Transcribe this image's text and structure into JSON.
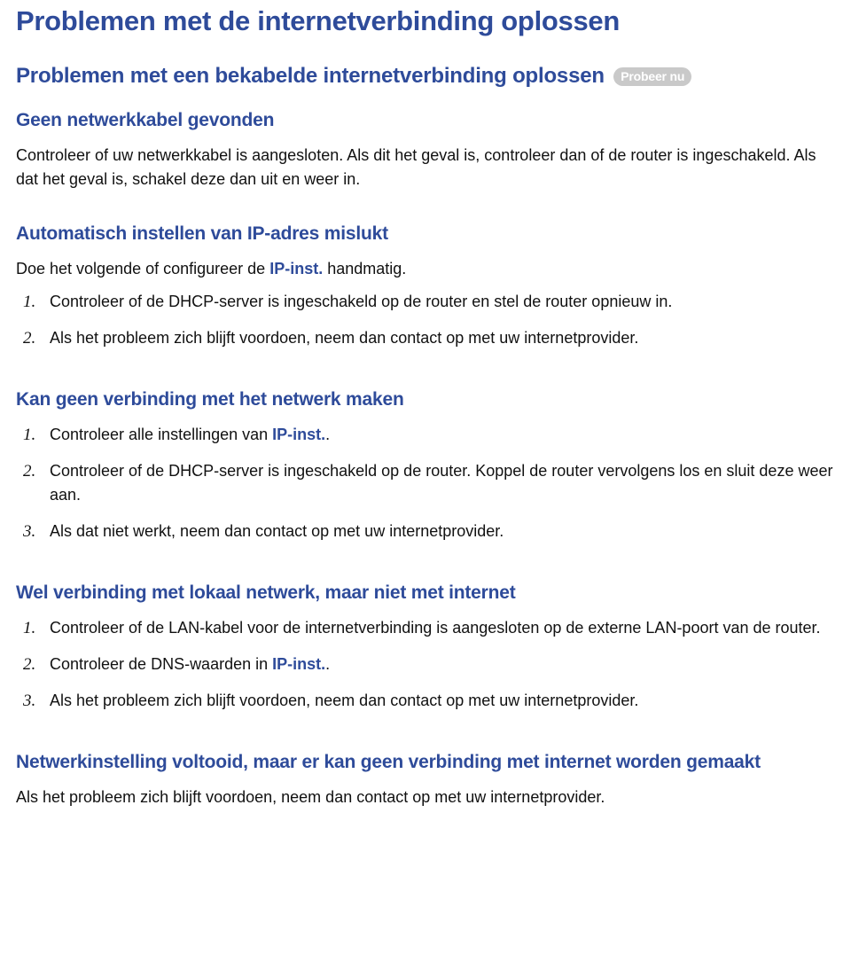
{
  "title": "Problemen met de internetverbinding oplossen",
  "wired": {
    "heading": "Problemen met een bekabelde internetverbinding oplossen",
    "badge": "Probeer nu"
  },
  "sec1": {
    "heading": "Geen netwerkkabel gevonden",
    "body": "Controleer of uw netwerkkabel is aangesloten. Als dit het geval is, controleer dan of de router is ingeschakeld. Als dat het geval is, schakel deze dan uit en weer in."
  },
  "sec2": {
    "heading": "Automatisch instellen van IP-adres mislukt",
    "intro_prefix": "Doe het volgende of configureer de ",
    "ip_inst": "IP-inst.",
    "intro_suffix": " handmatig.",
    "item1": "Controleer of de DHCP-server is ingeschakeld op de router en stel de router opnieuw in.",
    "item2": "Als het probleem zich blijft voordoen, neem dan contact op met uw internetprovider."
  },
  "sec3": {
    "heading": "Kan geen verbinding met het netwerk maken",
    "item1_prefix": "Controleer alle instellingen van ",
    "ip_inst": "IP-inst.",
    "item1_suffix": ".",
    "item2": "Controleer of de DHCP-server is ingeschakeld op de router. Koppel de router vervolgens los en sluit deze weer aan.",
    "item3": "Als dat niet werkt, neem dan contact op met uw internetprovider."
  },
  "sec4": {
    "heading": "Wel verbinding met lokaal netwerk, maar niet met internet",
    "item1": "Controleer of de LAN-kabel voor de internetverbinding is aangesloten op de externe LAN-poort van de router.",
    "item2_prefix": "Controleer de DNS-waarden in ",
    "ip_inst": "IP-inst.",
    "item2_suffix": ".",
    "item3": "Als het probleem zich blijft voordoen, neem dan contact op met uw internetprovider."
  },
  "sec5": {
    "heading": "Netwerkinstelling voltooid, maar er kan geen verbinding met internet worden gemaakt",
    "body": "Als het probleem zich blijft voordoen, neem dan contact op met uw internetprovider."
  },
  "nums": {
    "n1": "1.",
    "n2": "2.",
    "n3": "3."
  }
}
